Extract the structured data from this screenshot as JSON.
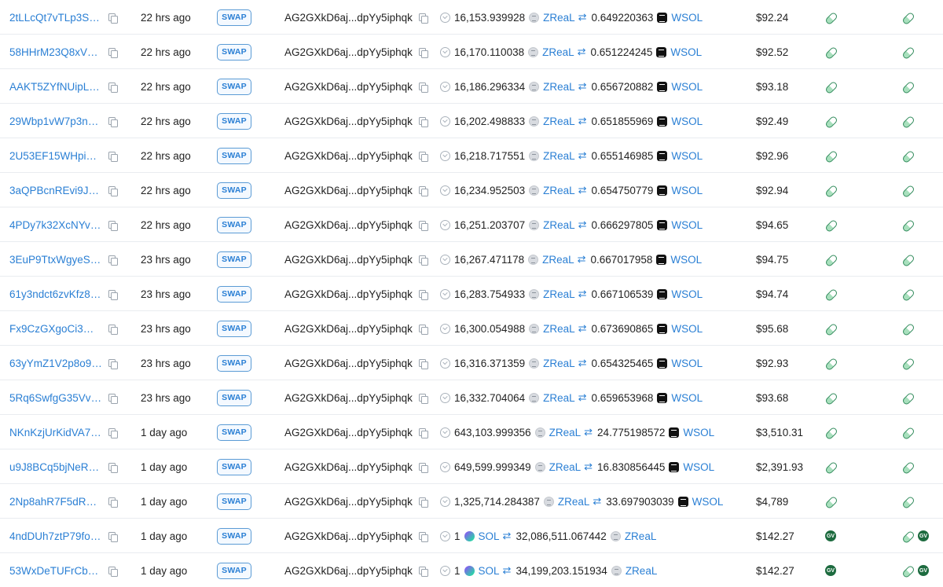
{
  "rows": [
    {
      "sig": "2tLLcQt7vTLp3SC...",
      "time": "22 hrs ago",
      "type": "SWAP",
      "by": "AG2GXkD6aj...dpYy5iphqk",
      "amt1": "16,153.939928",
      "tok1": "ZReaL",
      "amt2": "0.649220363",
      "tok2": "WSOL",
      "value": "$92.24",
      "kind": "zreal"
    },
    {
      "sig": "58HHrM23Q8xVw1...",
      "time": "22 hrs ago",
      "type": "SWAP",
      "by": "AG2GXkD6aj...dpYy5iphqk",
      "amt1": "16,170.110038",
      "tok1": "ZReaL",
      "amt2": "0.651224245",
      "tok2": "WSOL",
      "value": "$92.52",
      "kind": "zreal"
    },
    {
      "sig": "AAKT5ZYfNUipLqQ...",
      "time": "22 hrs ago",
      "type": "SWAP",
      "by": "AG2GXkD6aj...dpYy5iphqk",
      "amt1": "16,186.296334",
      "tok1": "ZReaL",
      "amt2": "0.656720882",
      "tok2": "WSOL",
      "value": "$93.18",
      "kind": "zreal"
    },
    {
      "sig": "29Wbp1vW7p3nZ...",
      "time": "22 hrs ago",
      "type": "SWAP",
      "by": "AG2GXkD6aj...dpYy5iphqk",
      "amt1": "16,202.498833",
      "tok1": "ZReaL",
      "amt2": "0.651855969",
      "tok2": "WSOL",
      "value": "$92.49",
      "kind": "zreal"
    },
    {
      "sig": "2U53EF15WHpie3...",
      "time": "22 hrs ago",
      "type": "SWAP",
      "by": "AG2GXkD6aj...dpYy5iphqk",
      "amt1": "16,218.717551",
      "tok1": "ZReaL",
      "amt2": "0.655146985",
      "tok2": "WSOL",
      "value": "$92.96",
      "kind": "zreal"
    },
    {
      "sig": "3aQPBcnREvi9JQc...",
      "time": "22 hrs ago",
      "type": "SWAP",
      "by": "AG2GXkD6aj...dpYy5iphqk",
      "amt1": "16,234.952503",
      "tok1": "ZReaL",
      "amt2": "0.654750779",
      "tok2": "WSOL",
      "value": "$92.94",
      "kind": "zreal"
    },
    {
      "sig": "4PDy7k32XcNYvw...",
      "time": "22 hrs ago",
      "type": "SWAP",
      "by": "AG2GXkD6aj...dpYy5iphqk",
      "amt1": "16,251.203707",
      "tok1": "ZReaL",
      "amt2": "0.666297805",
      "tok2": "WSOL",
      "value": "$94.65",
      "kind": "zreal"
    },
    {
      "sig": "3EuP9TtxWgyeSbv...",
      "time": "23 hrs ago",
      "type": "SWAP",
      "by": "AG2GXkD6aj...dpYy5iphqk",
      "amt1": "16,267.471178",
      "tok1": "ZReaL",
      "amt2": "0.667017958",
      "tok2": "WSOL",
      "value": "$94.75",
      "kind": "zreal"
    },
    {
      "sig": "61y3ndct6zvKfz85...",
      "time": "23 hrs ago",
      "type": "SWAP",
      "by": "AG2GXkD6aj...dpYy5iphqk",
      "amt1": "16,283.754933",
      "tok1": "ZReaL",
      "amt2": "0.667106539",
      "tok2": "WSOL",
      "value": "$94.74",
      "kind": "zreal"
    },
    {
      "sig": "Fx9CzGXgoCi3MKs...",
      "time": "23 hrs ago",
      "type": "SWAP",
      "by": "AG2GXkD6aj...dpYy5iphqk",
      "amt1": "16,300.054988",
      "tok1": "ZReaL",
      "amt2": "0.673690865",
      "tok2": "WSOL",
      "value": "$95.68",
      "kind": "zreal"
    },
    {
      "sig": "63yYmZ1V2p8o9u...",
      "time": "23 hrs ago",
      "type": "SWAP",
      "by": "AG2GXkD6aj...dpYy5iphqk",
      "amt1": "16,316.371359",
      "tok1": "ZReaL",
      "amt2": "0.654325465",
      "tok2": "WSOL",
      "value": "$92.93",
      "kind": "zreal"
    },
    {
      "sig": "5Rq6SwfgG35VvVf...",
      "time": "23 hrs ago",
      "type": "SWAP",
      "by": "AG2GXkD6aj...dpYy5iphqk",
      "amt1": "16,332.704064",
      "tok1": "ZReaL",
      "amt2": "0.659653968",
      "tok2": "WSOL",
      "value": "$93.68",
      "kind": "zreal"
    },
    {
      "sig": "NKnKzjUrKidVA7sZ...",
      "time": "1 day ago",
      "type": "SWAP",
      "by": "AG2GXkD6aj...dpYy5iphqk",
      "amt1": "643,103.999356",
      "tok1": "ZReaL",
      "amt2": "24.775198572",
      "tok2": "WSOL",
      "value": "$3,510.31",
      "kind": "zreal"
    },
    {
      "sig": "u9J8BCq5bjNeRAK...",
      "time": "1 day ago",
      "type": "SWAP",
      "by": "AG2GXkD6aj...dpYy5iphqk",
      "amt1": "649,599.999349",
      "tok1": "ZReaL",
      "amt2": "16.830856445",
      "tok2": "WSOL",
      "value": "$2,391.93",
      "kind": "zreal"
    },
    {
      "sig": "2Np8ahR7F5dRq6...",
      "time": "1 day ago",
      "type": "SWAP",
      "by": "AG2GXkD6aj...dpYy5iphqk",
      "amt1": "1,325,714.284387",
      "tok1": "ZReaL",
      "amt2": "33.697903039",
      "tok2": "WSOL",
      "value": "$4,789",
      "kind": "zreal"
    },
    {
      "sig": "4ndDUh7ztP79foa...",
      "time": "1 day ago",
      "type": "SWAP",
      "by": "AG2GXkD6aj...dpYy5iphqk",
      "amt1": "1",
      "tok1": "SOL",
      "amt2": "32,086,511.067442",
      "tok2": "ZReaL",
      "value": "$142.27",
      "kind": "sol"
    },
    {
      "sig": "53WxDeTUFrCbs4r...",
      "time": "1 day ago",
      "type": "SWAP",
      "by": "AG2GXkD6aj...dpYy5iphqk",
      "amt1": "1",
      "tok1": "SOL",
      "amt2": "34,199,203.151934",
      "tok2": "ZReaL",
      "value": "$142.27",
      "kind": "sol"
    }
  ],
  "dex_badge_text": "GV",
  "icons": {
    "copy": "copy-icon",
    "status": "check-circle-icon",
    "swap": "swap-arrows-icon",
    "platform": "pill-icon"
  },
  "colors": {
    "link": "#2a7fd4",
    "badge_border": "#5b9bd5",
    "pill": "#2f8a5a",
    "dex": "#1d6b3f"
  }
}
